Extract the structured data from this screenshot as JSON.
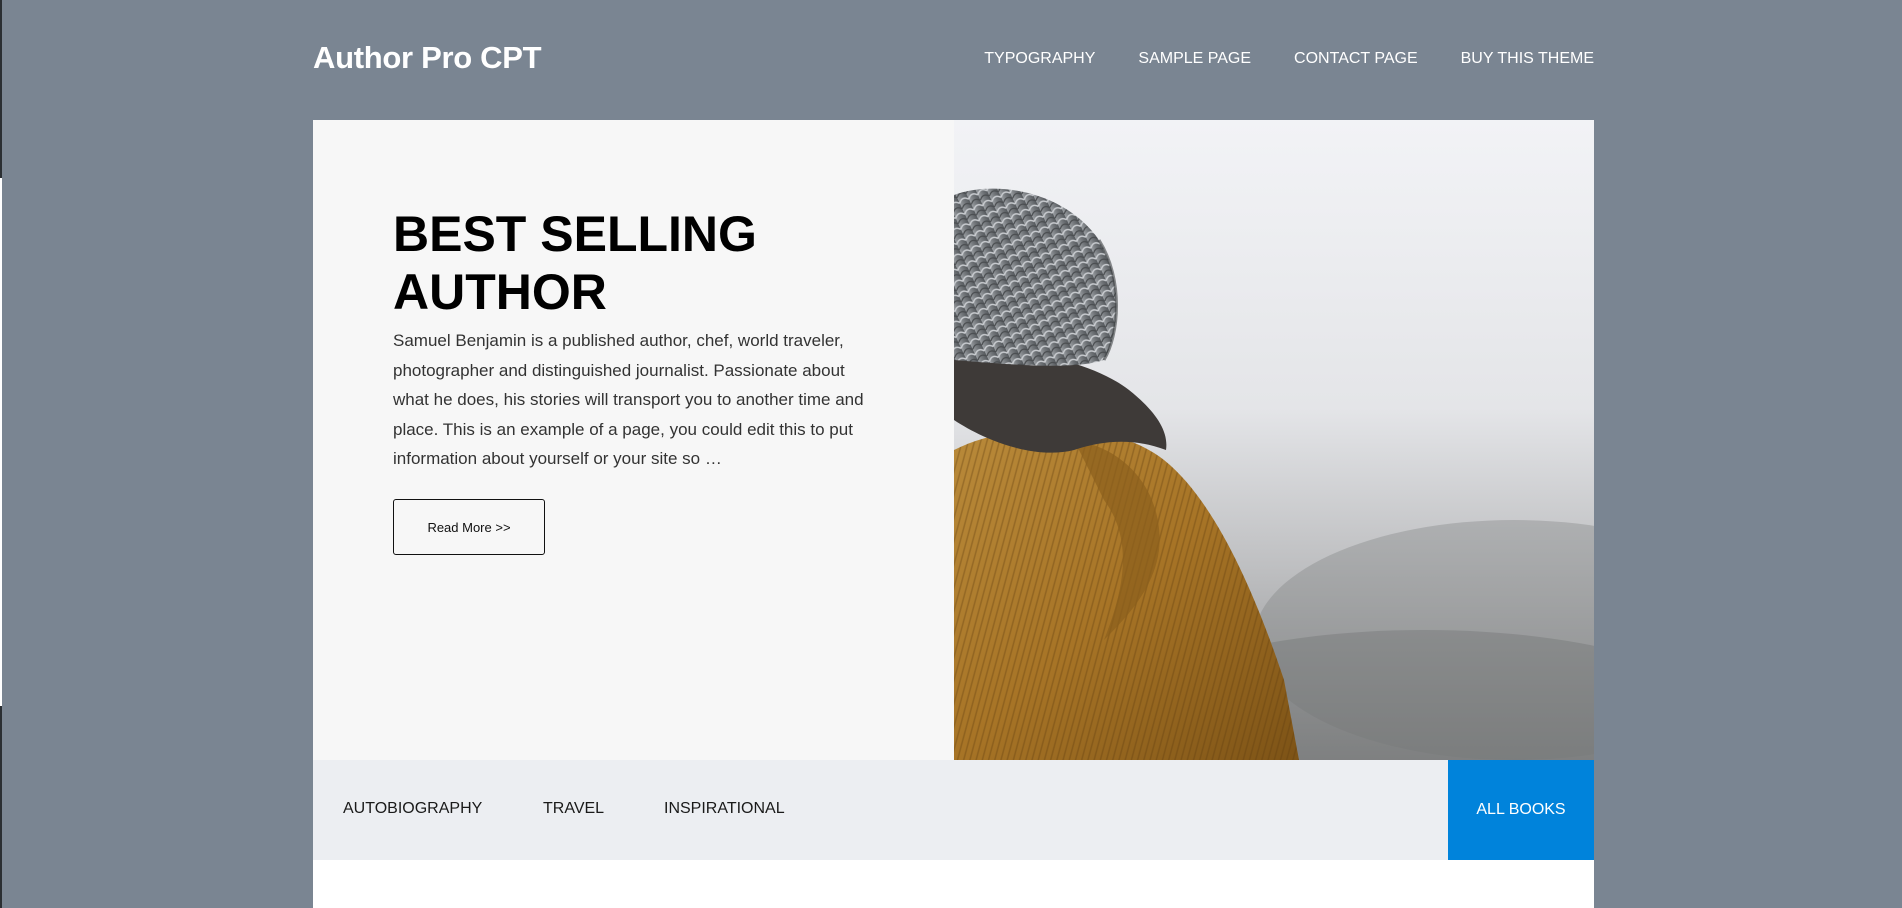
{
  "site": {
    "title": "Author Pro CPT"
  },
  "nav": {
    "items": [
      {
        "label": "TYPOGRAPHY"
      },
      {
        "label": "SAMPLE PAGE"
      },
      {
        "label": "CONTACT PAGE"
      },
      {
        "label": "BUY THIS THEME"
      }
    ]
  },
  "hero": {
    "title_line1": "BEST SELLING",
    "title_line2": "AUTHOR",
    "text": "Samuel Benjamin is a published author, chef, world traveler, photographer and distinguished journalist. Passionate about what he does, his stories will transport you to another time and place. This is an example of a page, you could edit this to put information about yourself or your site so …",
    "button_label": "Read More >>"
  },
  "categories": {
    "items": [
      {
        "label": "AUTOBIOGRAPHY"
      },
      {
        "label": "TRAVEL"
      },
      {
        "label": "INSPIRATIONAL"
      }
    ],
    "all_books_label": "ALL BOOKS"
  },
  "colors": {
    "page_background": "#7a8592",
    "accent": "#0083db",
    "hero_panel": "#f7f7f7",
    "category_bar": "#eceef2"
  }
}
